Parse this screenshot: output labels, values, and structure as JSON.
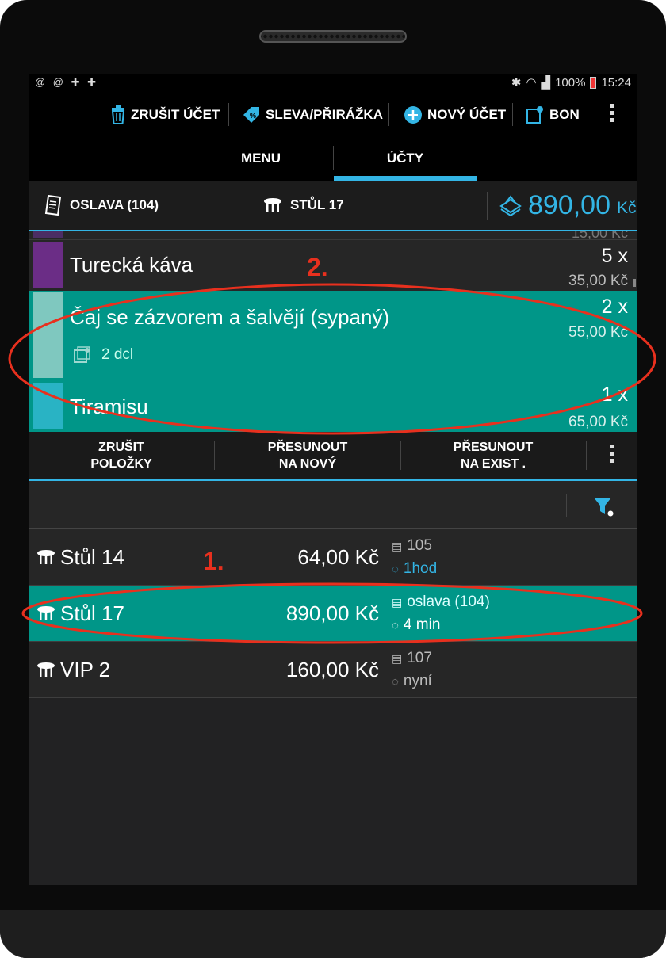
{
  "status_bar": {
    "left_icons": "@ @ ✚ ✚",
    "battery": "100%",
    "time": "15:24"
  },
  "action_bar": {
    "cancel_label": "ZRUŠIT ÚČET",
    "discount_label": "SLEVA/PŘIRÁŽKA",
    "new_label": "NOVÝ ÚČET",
    "bon_label": "BON"
  },
  "tabs": {
    "menu": "MENU",
    "accounts": "ÚČTY"
  },
  "account_header": {
    "name": "OSLAVA (104)",
    "table": "STŮL 17",
    "total": "890,00",
    "currency": "Kč"
  },
  "items": [
    {
      "name": "Turecká káva",
      "qty": "5 x",
      "price": "35,00 Kč",
      "color": "#6b2d86"
    },
    {
      "name": "Čaj se zázvorem a šalvějí (sypaný)",
      "qty": "2 x",
      "price": "55,00 Kč",
      "note": "2 dcl",
      "color": "#7fc8bf"
    },
    {
      "name": "Tiramisu",
      "qty": "1 x",
      "price": "65,00 Kč",
      "color": "#29b3c4"
    }
  ],
  "item_actions": {
    "cancel_items": [
      "ZRUŠIT",
      "POLOŽKY"
    ],
    "move_new": [
      "PŘESUNOUT",
      "NA NOVÝ"
    ],
    "move_existing": [
      "PŘESUNOUT",
      "NA EXIST ."
    ]
  },
  "accounts": [
    {
      "table": "Stůl 14",
      "total": "64,00 Kč",
      "id": "105",
      "time": "1hod"
    },
    {
      "table": "Stůl 17",
      "total": "890,00 Kč",
      "id": "oslava (104)",
      "time": "4 min"
    },
    {
      "table": "VIP 2",
      "total": "160,00 Kč",
      "id": "107",
      "time": "nyní"
    }
  ],
  "annotations": {
    "first": "1.",
    "second": "2."
  },
  "colors": {
    "accent": "#33b5e5",
    "selected": "#009688",
    "annotation": "#e8301e"
  }
}
